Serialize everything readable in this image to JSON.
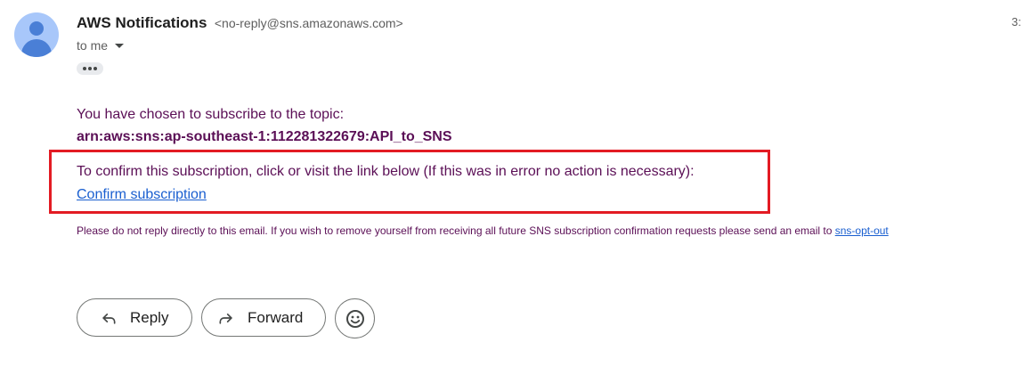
{
  "header": {
    "sender_name": "AWS Notifications",
    "sender_email": "<no-reply@sns.amazonaws.com>",
    "time": "3:",
    "recipient": "to me"
  },
  "message": {
    "intro": "You have chosen to subscribe to the topic:",
    "topic_arn": "arn:aws:sns:ap-southeast-1:112281322679:API_to_SNS",
    "confirm_text": "To confirm this subscription, click or visit the link below (If this was in error no action is necessary):",
    "confirm_link": "Confirm subscription",
    "footer_text": "Please do not reply directly to this email. If you wish to remove yourself from receiving all future SNS subscription confirmation requests please send an email to ",
    "footer_link": "sns-opt-out"
  },
  "actions": {
    "reply_label": "Reply",
    "forward_label": "Forward"
  },
  "colors": {
    "body_text": "#5b0f56",
    "link": "#1a5fd0",
    "highlight_box": "#e31b23",
    "avatar_bg": "#a8c7fa",
    "avatar_fg": "#4a7fd6"
  },
  "icons": {
    "avatar": "person-avatar-icon",
    "recipient_dropdown": "caret-down-icon",
    "trimmed_content": "more-horizontal-icon",
    "reply": "reply-arrow-icon",
    "forward": "forward-arrow-icon",
    "emoji": "emoji-smile-icon"
  }
}
